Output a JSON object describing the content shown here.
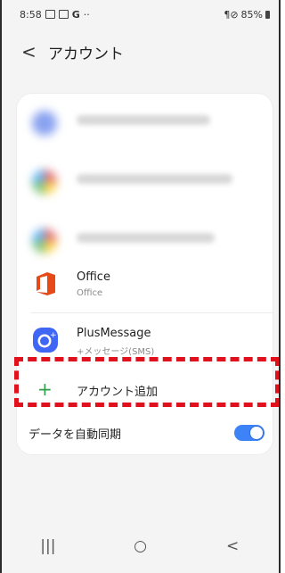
{
  "status_bar": {
    "time": "8:58",
    "icons": [
      "image-icon",
      "calendar-icon",
      "google-g-icon",
      "dots-icon"
    ],
    "google_glyph": "G",
    "more_glyph": "··",
    "right_text": "ℕ|⦰ 85%",
    "battery_percent": "85%"
  },
  "header": {
    "back_glyph": "<",
    "title": "アカウント"
  },
  "accounts": [
    {
      "name": "Office",
      "sub": "Office",
      "icon": "office-icon",
      "color": "#e64a19"
    },
    {
      "name": "PlusMessage",
      "sub": "+メッセージ(SMS)",
      "icon": "plusmessage-icon",
      "color": "#3f66f4"
    }
  ],
  "add_account": {
    "plus_glyph": "+",
    "label": "アカウント追加"
  },
  "sync": {
    "label": "データを自動同期",
    "enabled": true
  },
  "nav": {
    "recent_glyph": "|||",
    "home_glyph": "○",
    "back_glyph": "<"
  },
  "colors": {
    "accent_blue": "#3e82f7",
    "highlight_red": "#e0111d",
    "plus_green": "#2e9e48"
  }
}
